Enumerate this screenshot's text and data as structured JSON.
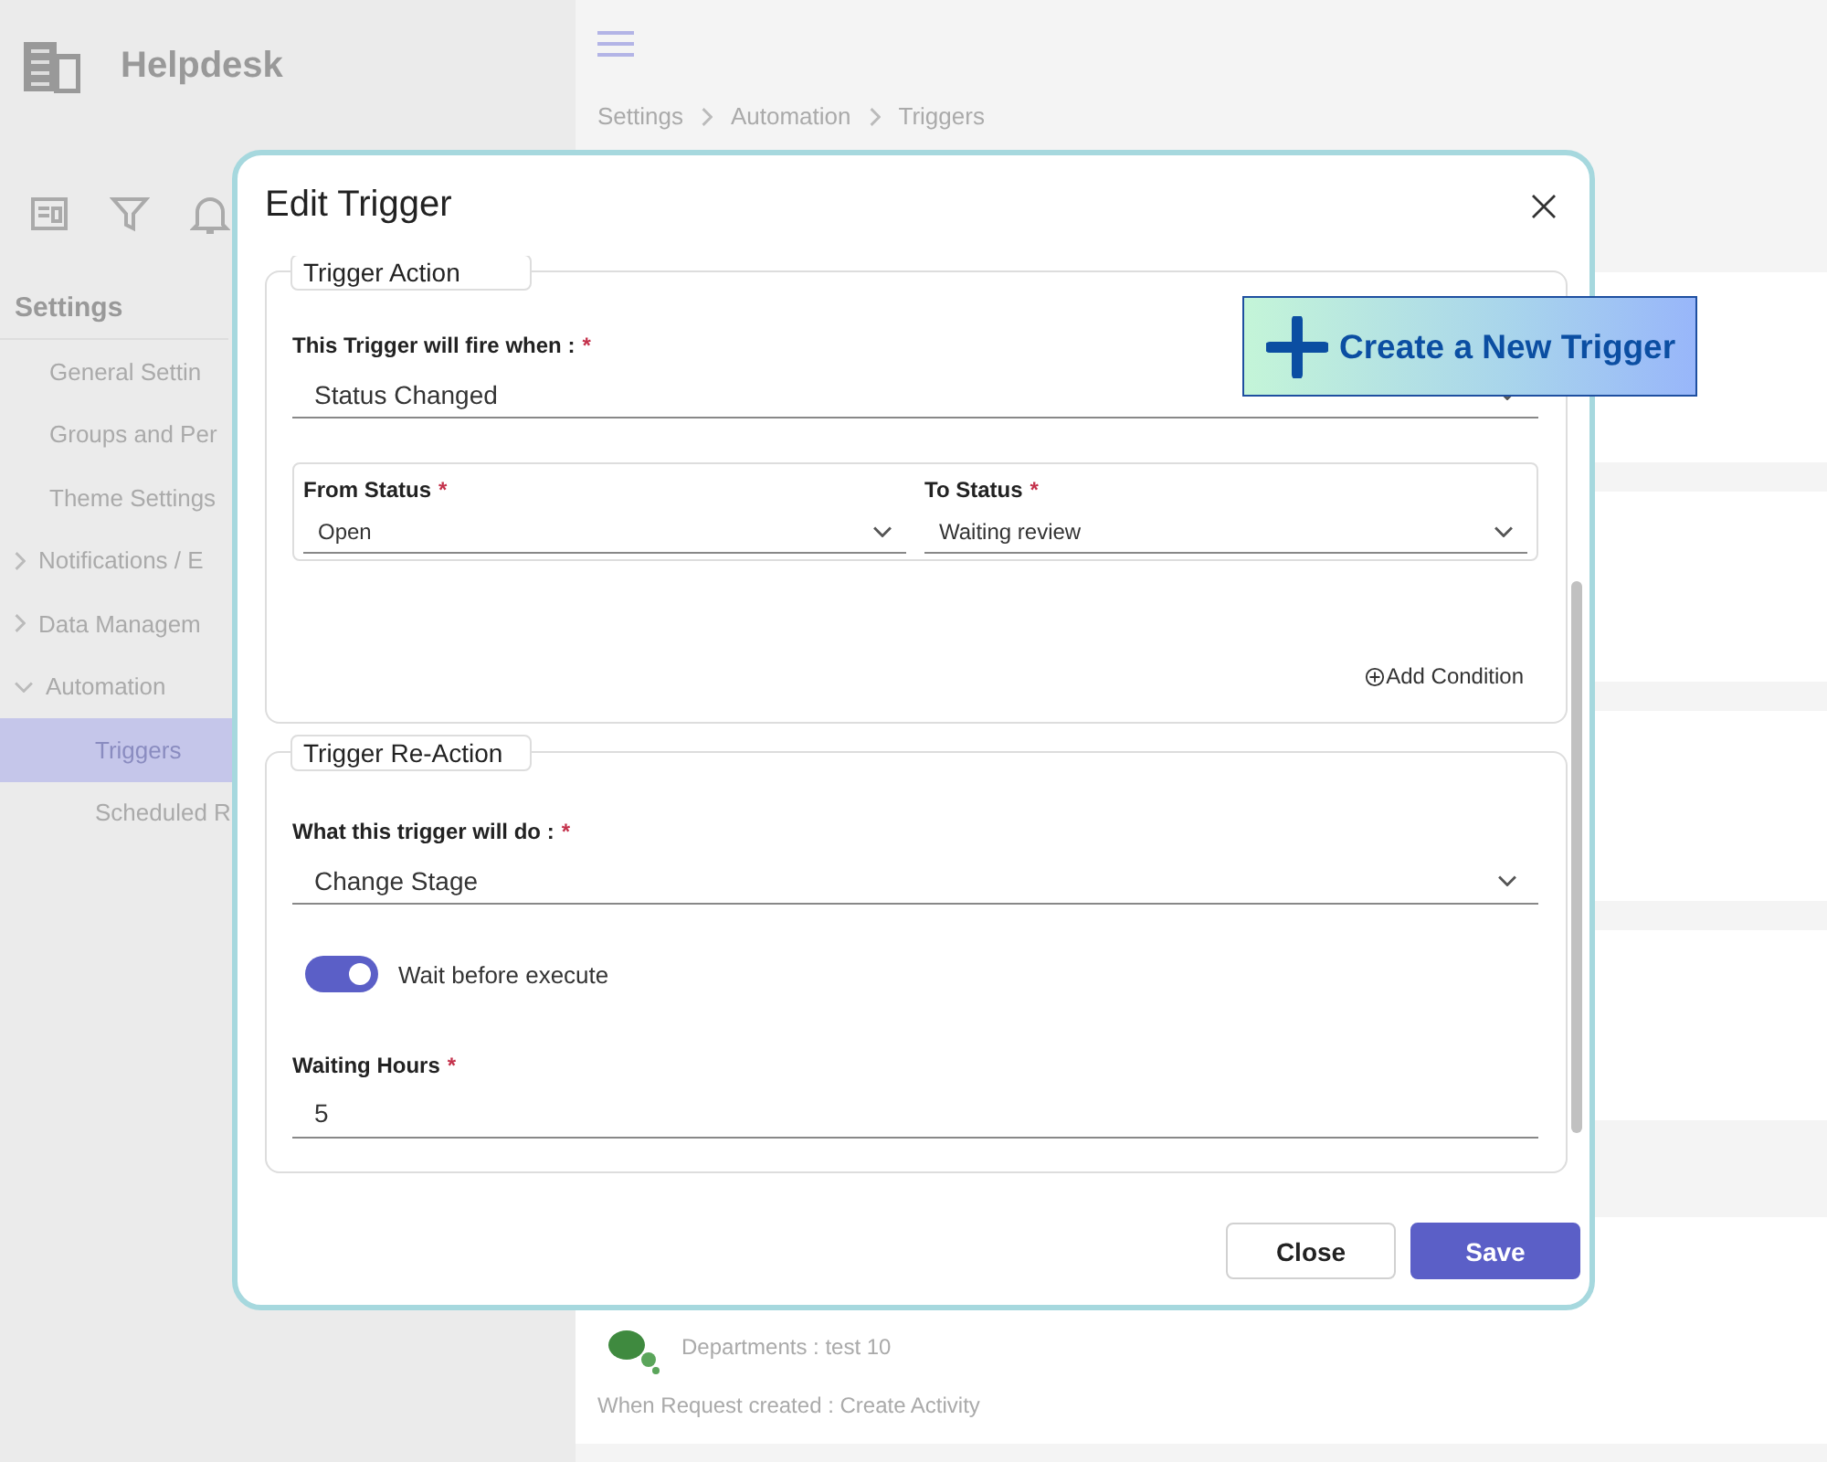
{
  "app": {
    "title": "Helpdesk"
  },
  "sidebar": {
    "heading": "Settings",
    "items": [
      {
        "label": "General Settin",
        "kind": "link",
        "selected": false
      },
      {
        "label": "Groups and Per",
        "kind": "link",
        "selected": false
      },
      {
        "label": "Theme Settings",
        "kind": "link",
        "selected": false
      },
      {
        "label": "Notifications / E",
        "kind": "group",
        "expanded": false,
        "selected": false
      },
      {
        "label": "Data Managem",
        "kind": "group",
        "expanded": false,
        "selected": false
      },
      {
        "label": "Automation",
        "kind": "group",
        "expanded": true,
        "selected": false,
        "children": [
          {
            "label": "Triggers",
            "kind": "link",
            "selected": true
          },
          {
            "label": "Scheduled R",
            "kind": "link",
            "selected": false
          }
        ]
      }
    ]
  },
  "breadcrumb": [
    "Settings",
    "Automation",
    "Triggers"
  ],
  "trigger_card": {
    "department": "Departments : test 10",
    "rule": "When Request created : Create Activity"
  },
  "dialog": {
    "title": "Edit Trigger",
    "sections": [
      {
        "legend": "Trigger Action",
        "fields": [
          {
            "kind": "select",
            "label": "This Trigger will fire when :",
            "required_mark": "*",
            "value": "Status Changed"
          },
          {
            "kind": "select_row",
            "fields": [
              {
                "label": "From Status",
                "required_mark": "*",
                "value": "Open"
              },
              {
                "label": "To Status",
                "required_mark": "*",
                "value": "Waiting review"
              }
            ]
          },
          {
            "kind": "action",
            "label": "Add Condition"
          }
        ]
      },
      {
        "legend": "Trigger Re-Action",
        "fields": [
          {
            "kind": "select",
            "label": "What this trigger will do :",
            "required_mark": "*",
            "value": "Change Stage"
          },
          {
            "kind": "toggle",
            "label": "Wait before execute",
            "on": true
          },
          {
            "kind": "text",
            "label": "Waiting Hours",
            "required_mark": "*",
            "value": "5"
          }
        ]
      }
    ],
    "buttons": [
      {
        "label": "Close",
        "kind": "secondary"
      },
      {
        "label": "Save",
        "kind": "primary"
      }
    ]
  },
  "promo": {
    "label": "Create a New Trigger"
  }
}
